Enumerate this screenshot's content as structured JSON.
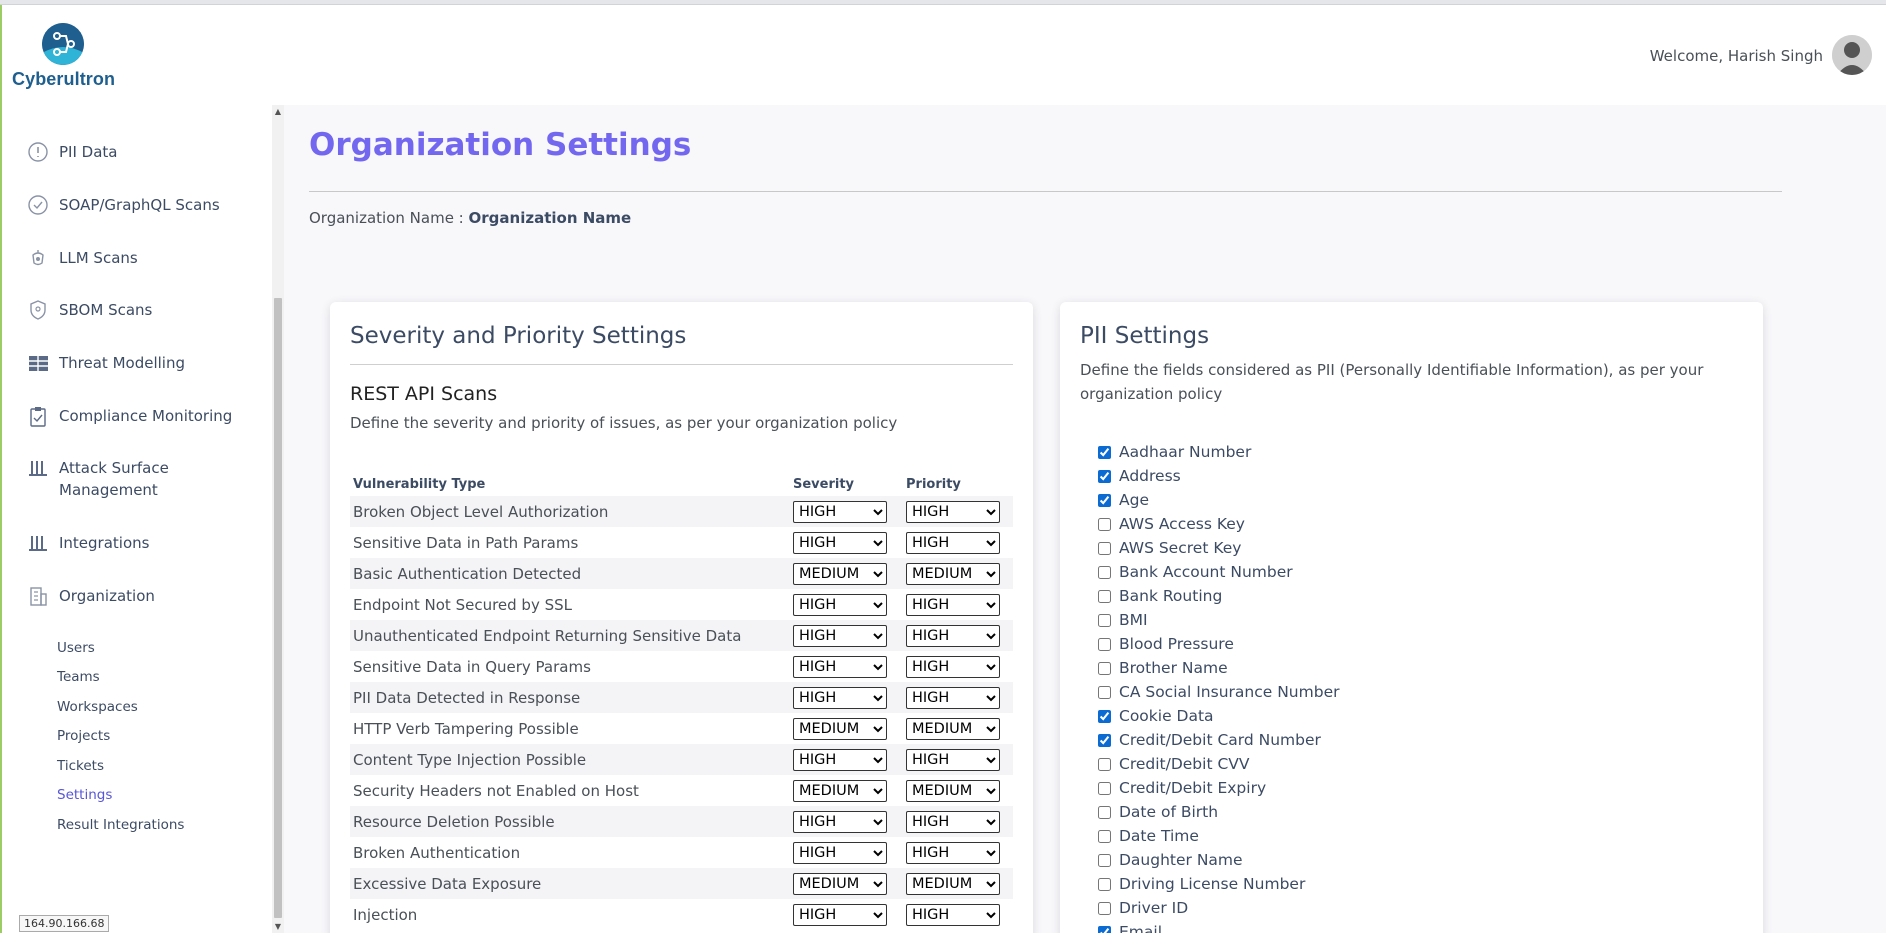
{
  "header": {
    "brand": "Cyberultron",
    "welcome": "Welcome, Harish Singh"
  },
  "sidebar": {
    "items": [
      {
        "label": "PII Data",
        "icon": "alert-circle-icon"
      },
      {
        "label": "SOAP/GraphQL Scans",
        "icon": "check-circle-icon"
      },
      {
        "label": "LLM Scans",
        "icon": "llm-icon"
      },
      {
        "label": "SBOM Scans",
        "icon": "shield-icon"
      },
      {
        "label": "Threat Modelling",
        "icon": "table-icon"
      },
      {
        "label": "Compliance Monitoring",
        "icon": "clipboard-icon"
      },
      {
        "label": "Attack Surface",
        "label2": "Management",
        "icon": "bars-icon"
      },
      {
        "label": "Integrations",
        "icon": "bars-icon"
      },
      {
        "label": "Organization",
        "icon": "building-icon"
      }
    ],
    "sub_items": [
      "Users",
      "Teams",
      "Workspaces",
      "Projects",
      "Tickets",
      "Settings",
      "Result Integrations"
    ],
    "active_sub": "Settings",
    "ip": "164.90.166.68"
  },
  "main": {
    "title": "Organization Settings",
    "org_label": "Organization Name :",
    "org_value": "Organization Name"
  },
  "severity_card": {
    "title": "Severity and Priority Settings",
    "subtitle": "REST API Scans",
    "description": "Define the severity and priority of issues, as per your organization policy",
    "columns": [
      "Vulnerability Type",
      "Severity",
      "Priority"
    ],
    "rows": [
      {
        "type": "Broken Object Level Authorization",
        "severity": "HIGH",
        "priority": "HIGH"
      },
      {
        "type": "Sensitive Data in Path Params",
        "severity": "HIGH",
        "priority": "HIGH"
      },
      {
        "type": "Basic Authentication Detected",
        "severity": "MEDIUM",
        "priority": "MEDIUM"
      },
      {
        "type": "Endpoint Not Secured by SSL",
        "severity": "HIGH",
        "priority": "HIGH"
      },
      {
        "type": "Unauthenticated Endpoint Returning Sensitive Data",
        "severity": "HIGH",
        "priority": "HIGH"
      },
      {
        "type": "Sensitive Data in Query Params",
        "severity": "HIGH",
        "priority": "HIGH"
      },
      {
        "type": "PII Data Detected in Response",
        "severity": "HIGH",
        "priority": "HIGH"
      },
      {
        "type": "HTTP Verb Tampering Possible",
        "severity": "MEDIUM",
        "priority": "MEDIUM"
      },
      {
        "type": "Content Type Injection Possible",
        "severity": "HIGH",
        "priority": "HIGH"
      },
      {
        "type": "Security Headers not Enabled on Host",
        "severity": "MEDIUM",
        "priority": "MEDIUM"
      },
      {
        "type": "Resource Deletion Possible",
        "severity": "HIGH",
        "priority": "HIGH"
      },
      {
        "type": "Broken Authentication",
        "severity": "HIGH",
        "priority": "HIGH"
      },
      {
        "type": "Excessive Data Exposure",
        "severity": "MEDIUM",
        "priority": "MEDIUM"
      },
      {
        "type": "Injection",
        "severity": "HIGH",
        "priority": "HIGH"
      }
    ]
  },
  "pii_card": {
    "title": "PII Settings",
    "description": "Define the fields considered as PII (Personally Identifiable Information), as per your organization policy",
    "fields": [
      {
        "label": "Aadhaar Number",
        "checked": true
      },
      {
        "label": "Address",
        "checked": true
      },
      {
        "label": "Age",
        "checked": true
      },
      {
        "label": "AWS Access Key",
        "checked": false
      },
      {
        "label": "AWS Secret Key",
        "checked": false
      },
      {
        "label": "Bank Account Number",
        "checked": false
      },
      {
        "label": "Bank Routing",
        "checked": false
      },
      {
        "label": "BMI",
        "checked": false
      },
      {
        "label": "Blood Pressure",
        "checked": false
      },
      {
        "label": "Brother Name",
        "checked": false
      },
      {
        "label": "CA Social Insurance Number",
        "checked": false
      },
      {
        "label": "Cookie Data",
        "checked": true
      },
      {
        "label": "Credit/Debit Card Number",
        "checked": true
      },
      {
        "label": "Credit/Debit CVV",
        "checked": false
      },
      {
        "label": "Credit/Debit Expiry",
        "checked": false
      },
      {
        "label": "Date of Birth",
        "checked": false
      },
      {
        "label": "Date Time",
        "checked": false
      },
      {
        "label": "Daughter Name",
        "checked": false
      },
      {
        "label": "Driving License Number",
        "checked": false
      },
      {
        "label": "Driver ID",
        "checked": false
      },
      {
        "label": "Email",
        "checked": true
      }
    ]
  },
  "colors": {
    "accent": "#7367f0",
    "active_link": "#5856d6",
    "brand": "#1f5f8f",
    "background": "#f8f8fb"
  }
}
